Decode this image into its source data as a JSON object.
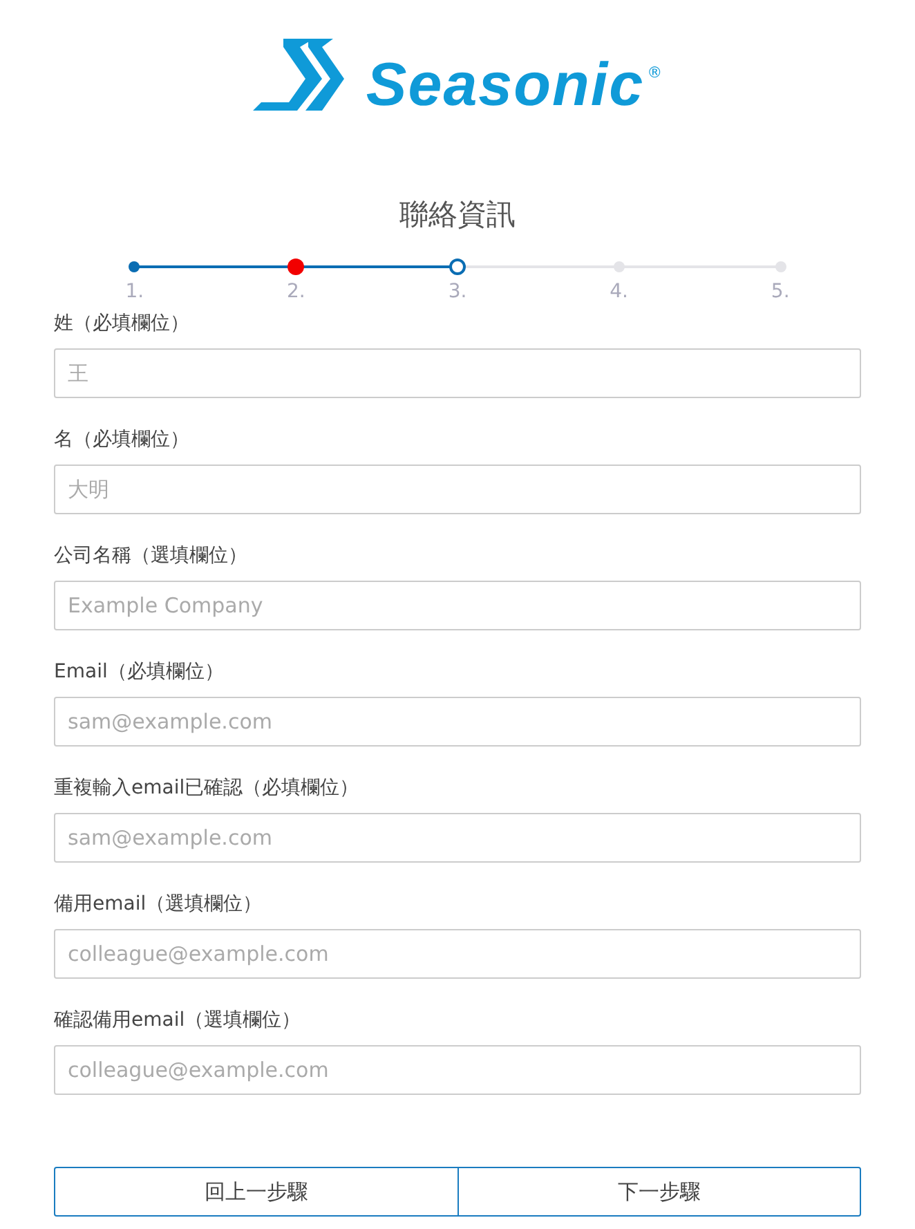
{
  "logo": {
    "name": "Seasonic",
    "mark": "®"
  },
  "title": "聯絡資訊",
  "steps": [
    {
      "label": "1.",
      "kind": "done"
    },
    {
      "label": "2.",
      "kind": "error"
    },
    {
      "label": "3.",
      "kind": "current"
    },
    {
      "label": "4.",
      "kind": "todo"
    },
    {
      "label": "5.",
      "kind": "todo"
    }
  ],
  "fields": [
    {
      "label": "姓（必填欄位）",
      "placeholder": "王"
    },
    {
      "label": "名（必填欄位）",
      "placeholder": "大明"
    },
    {
      "label": "公司名稱（選填欄位）",
      "placeholder": "Example Company"
    },
    {
      "label": "Email（必填欄位）",
      "placeholder": "sam@example.com"
    },
    {
      "label": "重複輸入email已確認（必填欄位）",
      "placeholder": "sam@example.com"
    },
    {
      "label": "備用email（選填欄位）",
      "placeholder": "colleague@example.com"
    },
    {
      "label": "確認備用email（選填欄位）",
      "placeholder": "colleague@example.com"
    }
  ],
  "buttons": [
    {
      "label": "回上一步驟"
    },
    {
      "label": "下一步驟"
    }
  ]
}
